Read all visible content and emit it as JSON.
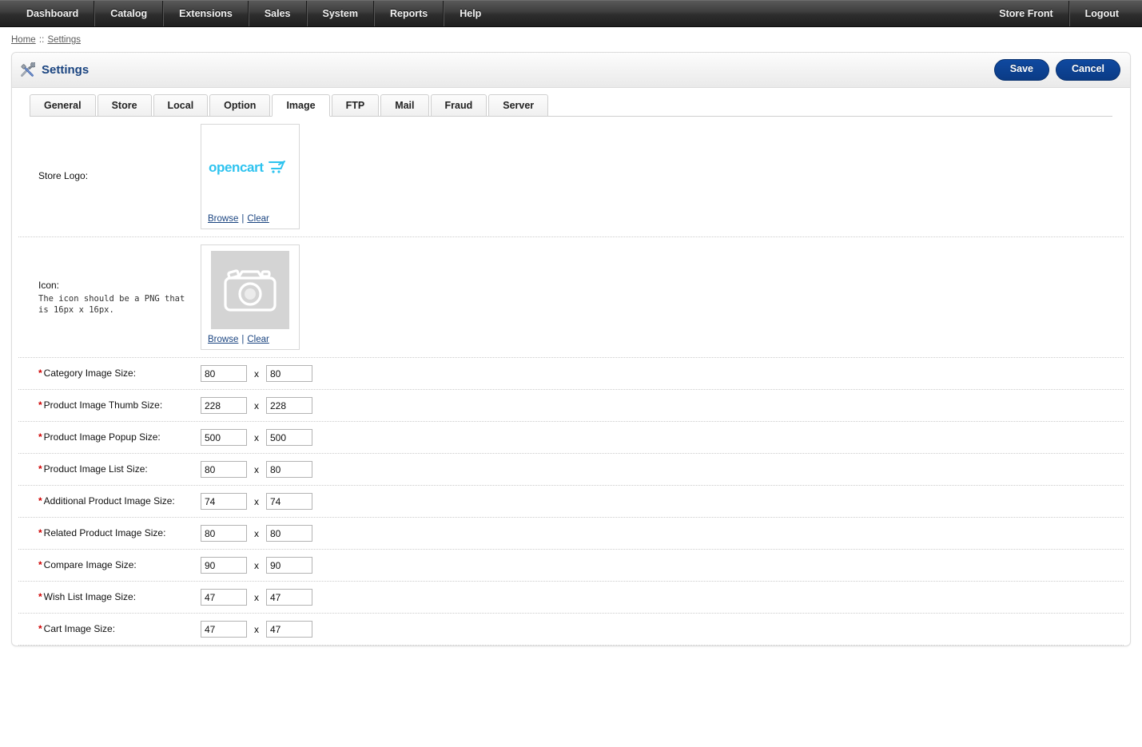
{
  "topnav": {
    "left_items": [
      {
        "label": "Dashboard",
        "name": "nav-item-dashboard"
      },
      {
        "label": "Catalog",
        "name": "nav-item-catalog"
      },
      {
        "label": "Extensions",
        "name": "nav-item-extensions"
      },
      {
        "label": "Sales",
        "name": "nav-item-sales"
      },
      {
        "label": "System",
        "name": "nav-item-system"
      },
      {
        "label": "Reports",
        "name": "nav-item-reports"
      },
      {
        "label": "Help",
        "name": "nav-item-help"
      }
    ],
    "right_items": [
      {
        "label": "Store Front",
        "name": "nav-item-store-front"
      },
      {
        "label": "Logout",
        "name": "nav-item-logout"
      }
    ]
  },
  "breadcrumb": {
    "home": "Home",
    "separator": " :: ",
    "current": "Settings"
  },
  "panel": {
    "title": "Settings",
    "icon": "tools-icon",
    "save_label": "Save",
    "cancel_label": "Cancel"
  },
  "tabs": [
    {
      "label": "General",
      "active": false
    },
    {
      "label": "Store",
      "active": false
    },
    {
      "label": "Local",
      "active": false
    },
    {
      "label": "Option",
      "active": false
    },
    {
      "label": "Image",
      "active": true
    },
    {
      "label": "FTP",
      "active": false
    },
    {
      "label": "Mail",
      "active": false
    },
    {
      "label": "Fraud",
      "active": false
    },
    {
      "label": "Server",
      "active": false
    }
  ],
  "media_rows": [
    {
      "label": "Store Logo:",
      "hint": "",
      "image_kind": "opencart-logo",
      "browse_label": "Browse",
      "separator": "|",
      "clear_label": "Clear"
    },
    {
      "label": "Icon:",
      "hint": "The icon should be a PNG that is 16px x 16px.",
      "image_kind": "image-placeholder",
      "browse_label": "Browse",
      "separator": "|",
      "clear_label": "Clear"
    }
  ],
  "size_rows": [
    {
      "required": "*",
      "label": "Category Image Size:",
      "width": "80",
      "sep": "x",
      "height": "80"
    },
    {
      "required": "*",
      "label": "Product Image Thumb Size:",
      "width": "228",
      "sep": "x",
      "height": "228"
    },
    {
      "required": "*",
      "label": "Product Image Popup Size:",
      "width": "500",
      "sep": "x",
      "height": "500"
    },
    {
      "required": "*",
      "label": "Product Image List Size:",
      "width": "80",
      "sep": "x",
      "height": "80"
    },
    {
      "required": "*",
      "label": "Additional Product Image Size:",
      "width": "74",
      "sep": "x",
      "height": "74"
    },
    {
      "required": "*",
      "label": "Related Product Image Size:",
      "width": "80",
      "sep": "x",
      "height": "80"
    },
    {
      "required": "*",
      "label": "Compare Image Size:",
      "width": "90",
      "sep": "x",
      "height": "90"
    },
    {
      "required": "*",
      "label": "Wish List Image Size:",
      "width": "47",
      "sep": "x",
      "height": "47"
    },
    {
      "required": "*",
      "label": "Cart Image Size:",
      "width": "47",
      "sep": "x",
      "height": "47"
    }
  ],
  "colors": {
    "accent_blue": "#1a4480",
    "button_blue": "#0b3b85",
    "required_red": "#d00000",
    "logo_cyan": "#2ec3ef",
    "nav_dark": "#2e2e2e"
  }
}
